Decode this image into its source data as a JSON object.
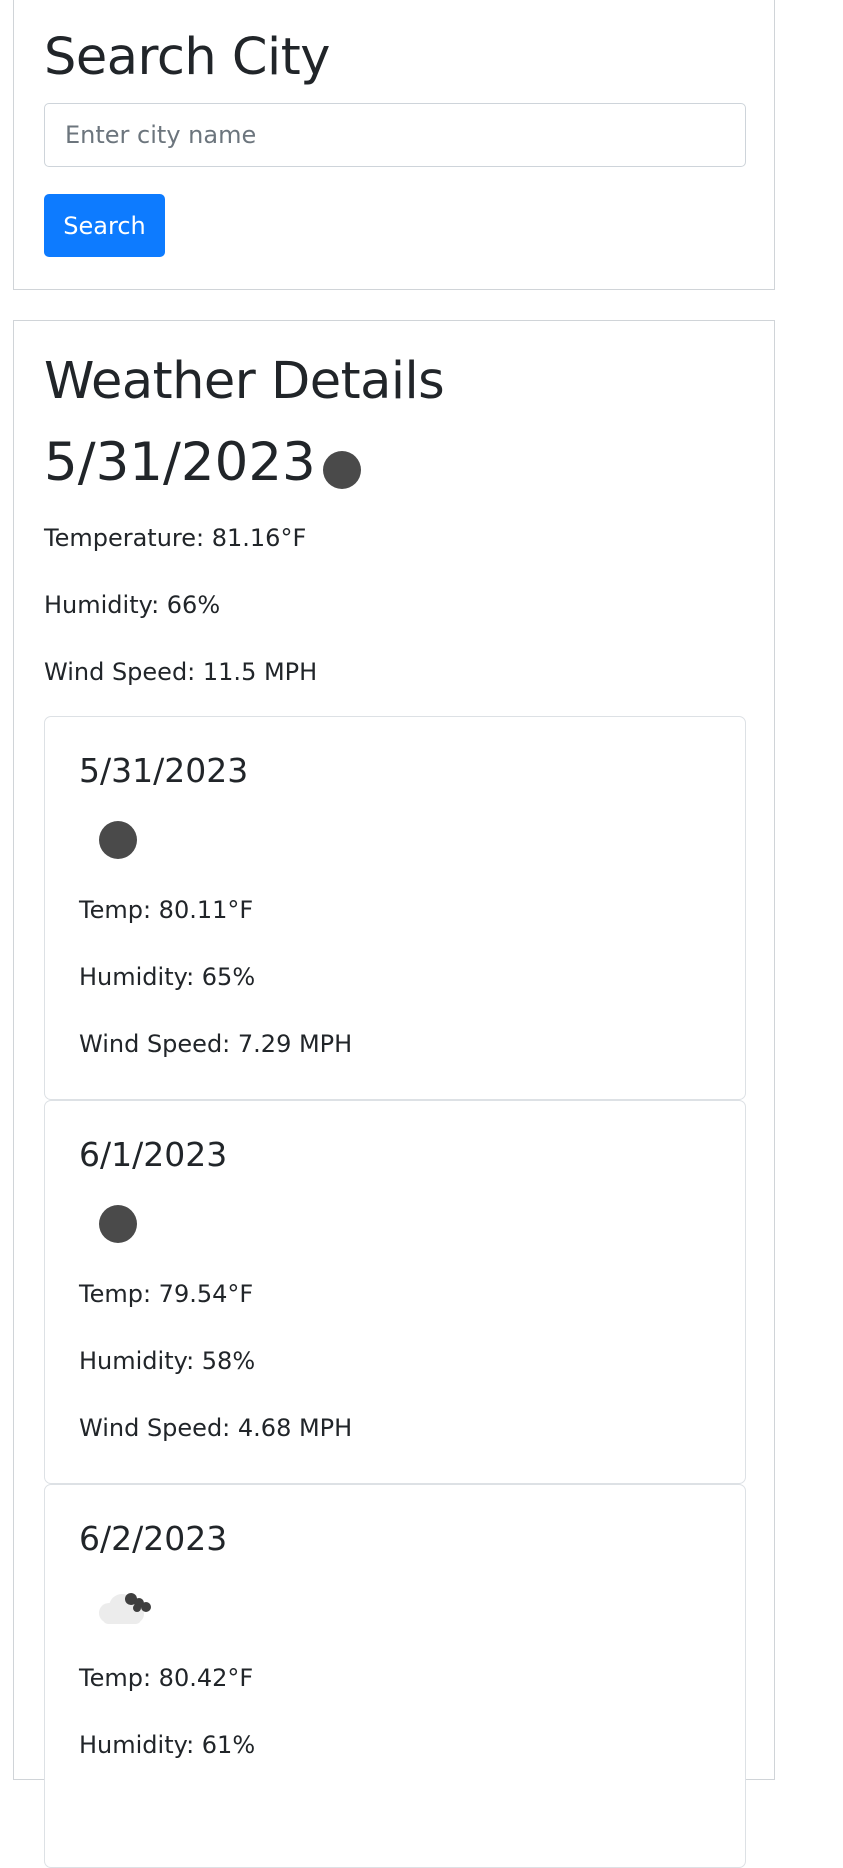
{
  "search": {
    "title": "Search City",
    "placeholder": "Enter city name",
    "value": "",
    "button_label": "Search"
  },
  "weather": {
    "title": "Weather Details",
    "date": "5/31/2023",
    "icon": "dark-dot-icon",
    "temperature": "Temperature: 81.16°F",
    "humidity": "Humidity: 66%",
    "wind": "Wind Speed: 11.5 MPH"
  },
  "forecast": [
    {
      "date": "5/31/2023",
      "icon": "dark-dot-icon",
      "temp": "Temp: 80.11°F",
      "humidity": "Humidity: 65%",
      "wind": "Wind Speed: 7.29 MPH"
    },
    {
      "date": "6/1/2023",
      "icon": "dark-dot-icon",
      "temp": "Temp: 79.54°F",
      "humidity": "Humidity: 58%",
      "wind": "Wind Speed: 4.68 MPH"
    },
    {
      "date": "6/2/2023",
      "icon": "cloud-icon",
      "temp": "Temp: 80.42°F",
      "humidity": "Humidity: 61%",
      "wind": ""
    }
  ],
  "colors": {
    "button": "#0d7bff",
    "text": "#212529",
    "icon_dark": "#4a4a4a"
  }
}
